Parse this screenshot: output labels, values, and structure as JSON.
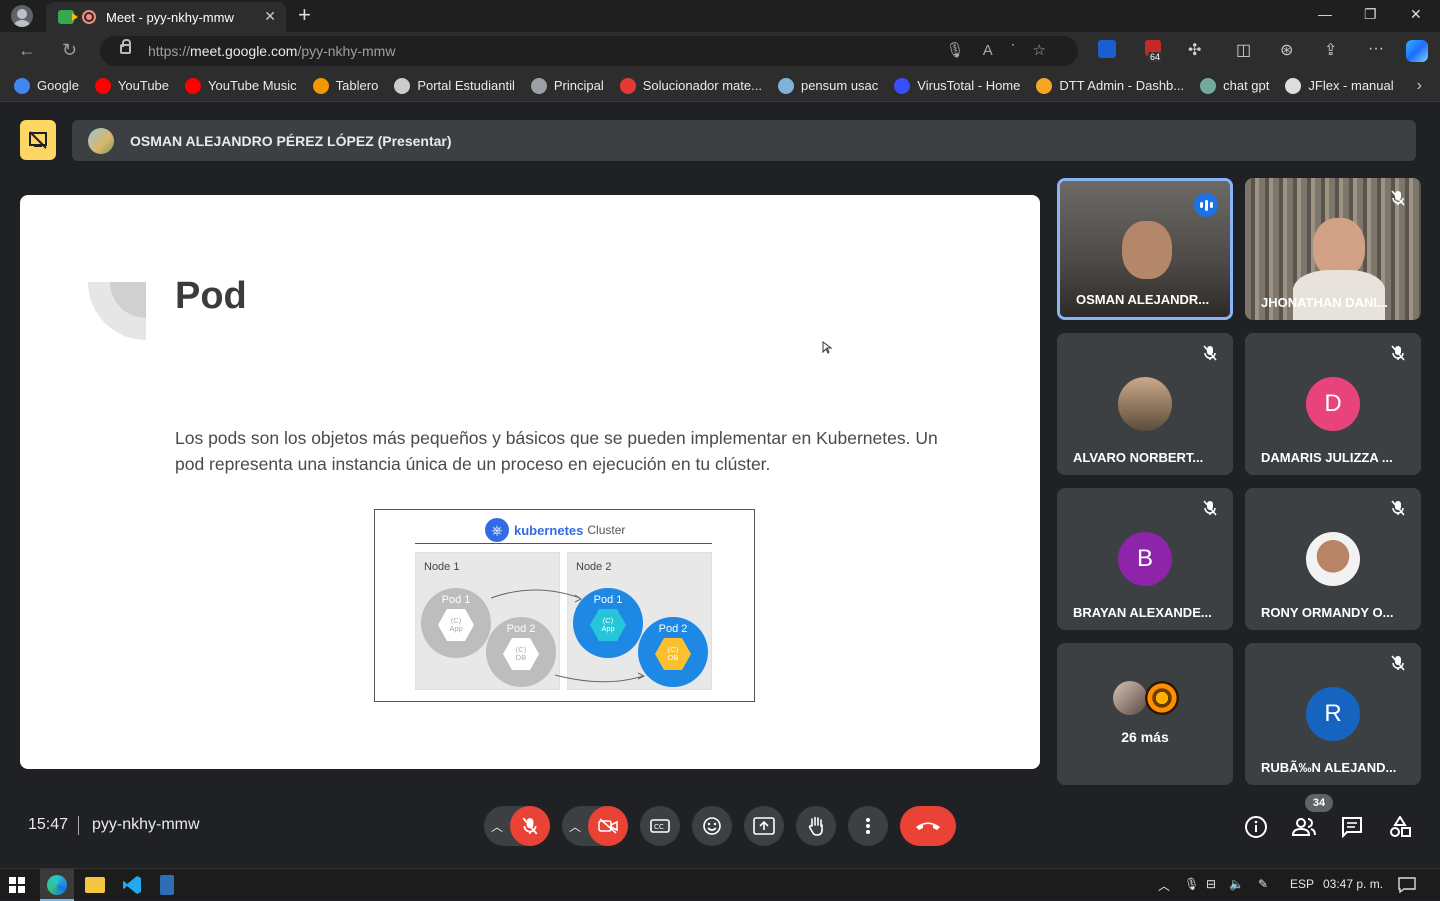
{
  "browser": {
    "tab_title": "Meet - pyy-nkhy-mmw",
    "url_scheme": "https://",
    "url_host": "meet.google.com",
    "url_path": "/pyy-nkhy-mmw",
    "ext_badge": "64",
    "bookmarks": [
      {
        "label": "Google",
        "color": "#4285f4"
      },
      {
        "label": "YouTube",
        "color": "#ff0000"
      },
      {
        "label": "YouTube Music",
        "color": "#ff0000"
      },
      {
        "label": "Tablero",
        "color": "#f29900"
      },
      {
        "label": "Portal Estudiantil",
        "color": "#cccccc"
      },
      {
        "label": "Principal",
        "color": "#9aa0a6"
      },
      {
        "label": "Solucionador mate...",
        "color": "#e53935"
      },
      {
        "label": "pensum usac",
        "color": "#7fb3d5"
      },
      {
        "label": "VirusTotal - Home",
        "color": "#394eff"
      },
      {
        "label": "DTT Admin - Dashb...",
        "color": "#f6a623"
      },
      {
        "label": "chat gpt",
        "color": "#74aa9c"
      },
      {
        "label": "JFlex - manual",
        "color": "#dddddd"
      }
    ]
  },
  "meet": {
    "presenter_label": "OSMAN ALEJANDRO PÉREZ LÓPEZ (Presentar)",
    "slide": {
      "title": "Pod",
      "body": "Los pods son los objetos más pequeños y básicos que se pueden implementar en Kubernetes. Un pod representa una instancia única de un proceso en ejecución en tu clúster.",
      "diagram": {
        "brand": "kubernetes",
        "cluster": "Cluster",
        "node1": "Node 1",
        "node2": "Node 2",
        "pod1": "Pod 1",
        "pod2": "Pod 2",
        "app": "(C)\nApp",
        "db": "(C)\nDB"
      }
    },
    "participants": [
      {
        "name": "OSMAN ALEJANDR...",
        "speaking": true
      },
      {
        "name": "JHONATHAN DANI...",
        "muted": true
      },
      {
        "name": "ALVARO NORBERT...",
        "muted": true
      },
      {
        "name": "DAMARIS JULIZZA ...",
        "initial": "D",
        "color": "#e8437a",
        "muted": true
      },
      {
        "name": "BRAYAN ALEXANDE...",
        "initial": "B",
        "color": "#8e24aa",
        "muted": true
      },
      {
        "name": "RONY ORMANDY O...",
        "muted": true
      },
      {
        "name": "26 más"
      },
      {
        "name": "RUBÃ‰N ALEJAND...",
        "initial": "R",
        "color": "#1565c0",
        "muted": true
      }
    ],
    "time": "15:47",
    "meeting_code": "pyy-nkhy-mmw",
    "people_count": "34"
  },
  "taskbar": {
    "lang": "ESP",
    "clock": "03:47 p. m."
  },
  "colors": {
    "accent": "#8ab4f8",
    "danger": "#ea4335",
    "present": "#fdd663"
  }
}
